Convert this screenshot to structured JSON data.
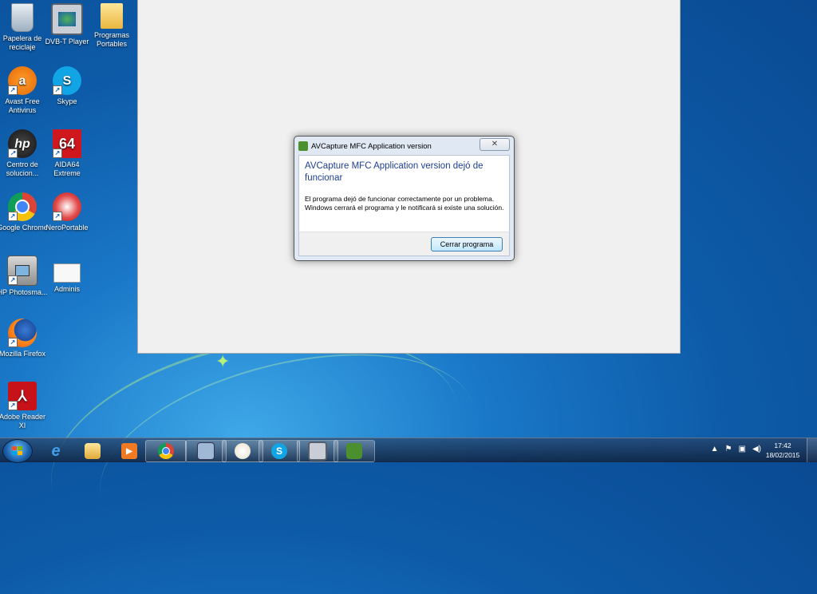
{
  "desktop": {
    "icons": [
      {
        "label": "Papelera de reciclaje",
        "icon": "recycle-bin-icon"
      },
      {
        "label": "DVB-T Player",
        "icon": "dvbt-player-icon"
      },
      {
        "label": "Programas Portables",
        "icon": "folder-icon"
      },
      {
        "label": "Avast Free Antivirus",
        "icon": "avast-icon"
      },
      {
        "label": "Skype",
        "icon": "skype-icon"
      },
      {
        "label": "Centro de solucion...",
        "icon": "hp-solution-center-icon"
      },
      {
        "label": "AIDA64 Extreme",
        "icon": "aida64-icon",
        "glyph": "64"
      },
      {
        "label": "Google Chrome",
        "icon": "chrome-icon"
      },
      {
        "label": "NeroPortable",
        "icon": "nero-icon"
      },
      {
        "label": "HP Photosma...",
        "icon": "hp-photosmart-icon"
      },
      {
        "label": "Adminis",
        "icon": "adminis-icon"
      },
      {
        "label": "Mozilla Firefox",
        "icon": "firefox-icon"
      },
      {
        "label": "Adobe Reader XI",
        "icon": "adobe-reader-icon"
      }
    ]
  },
  "dialog": {
    "title": "AVCapture MFC Application version",
    "close_glyph": "✕",
    "heading": "AVCapture MFC Application version dejó de funcionar",
    "message": "El programa dejó de funcionar correctamente por un problema. Windows cerrará el programa y le notificará si existe una solución.",
    "button_label": "Cerrar programa"
  },
  "taskbar": {
    "pinned": [
      {
        "name": "internet-explorer",
        "icon": "ie-icon",
        "glyph": "e",
        "open": false
      },
      {
        "name": "explorer",
        "icon": "folder-icon",
        "open": false
      },
      {
        "name": "media-player",
        "icon": "media-player-icon",
        "open": false
      },
      {
        "name": "chrome",
        "icon": "chrome-icon",
        "open": true
      },
      {
        "name": "network",
        "icon": "network-icon",
        "open": true
      },
      {
        "name": "paint",
        "icon": "paint-icon",
        "open": true
      },
      {
        "name": "skype",
        "icon": "skype-icon",
        "glyph": "S",
        "open": true
      },
      {
        "name": "dvbt",
        "icon": "dvbt-player-icon",
        "open": true
      },
      {
        "name": "avcapture",
        "icon": "avcapture-icon",
        "open": true
      }
    ],
    "tray": {
      "chevron": "▲",
      "flag": "⚑",
      "network": "▣",
      "volume": "◀)"
    },
    "time": "17:42",
    "date": "18/02/2015"
  },
  "colors": {
    "dialog_heading": "#1e3f95",
    "desktop_bg": "#0d5ba8"
  }
}
